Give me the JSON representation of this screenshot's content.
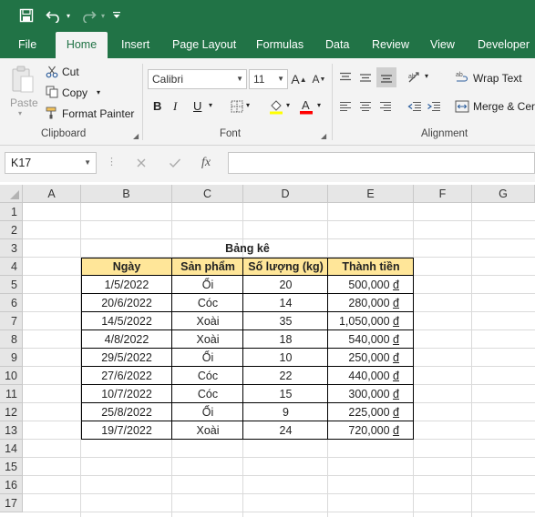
{
  "quick_access": {
    "save_icon": "save-icon",
    "undo_icon": "undo-icon",
    "redo_icon": "redo-icon",
    "customize_icon": "customize-icon"
  },
  "tabs": [
    {
      "label": "File"
    },
    {
      "label": "Home"
    },
    {
      "label": "Insert"
    },
    {
      "label": "Page Layout"
    },
    {
      "label": "Formulas"
    },
    {
      "label": "Data"
    },
    {
      "label": "Review"
    },
    {
      "label": "View"
    },
    {
      "label": "Developer"
    }
  ],
  "active_tab": "Home",
  "ribbon": {
    "clipboard": {
      "paste": "Paste",
      "cut": "Cut",
      "copy": "Copy",
      "format_painter": "Format Painter",
      "group_label": "Clipboard"
    },
    "font": {
      "font_name": "Calibri",
      "font_size": "11",
      "bold": "B",
      "italic": "I",
      "underline": "U",
      "group_label": "Font"
    },
    "alignment": {
      "wrap_text": "Wrap Text",
      "merge": "Merge & Cer",
      "group_label": "Alignment"
    }
  },
  "formula_bar": {
    "name_box": "K17",
    "fx": "fx",
    "formula": ""
  },
  "sheet": {
    "columns": [
      "A",
      "B",
      "C",
      "D",
      "E",
      "F",
      "G"
    ],
    "rows": [
      "1",
      "2",
      "3",
      "4",
      "5",
      "6",
      "7",
      "8",
      "9",
      "10",
      "11",
      "12",
      "13",
      "14",
      "15",
      "16",
      "17"
    ],
    "table_title": "Bảng kê",
    "headers": [
      "Ngày",
      "Sản phẩm",
      "Số lượng (kg)",
      "Thành tiền"
    ],
    "currency_symbol": "đ",
    "data": [
      [
        "1/5/2022",
        "Ổi",
        "20",
        "500,000"
      ],
      [
        "20/6/2022",
        "Cóc",
        "14",
        "280,000"
      ],
      [
        "14/5/2022",
        "Xoài",
        "35",
        "1,050,000"
      ],
      [
        "4/8/2022",
        "Xoài",
        "18",
        "540,000"
      ],
      [
        "29/5/2022",
        "Ổi",
        "10",
        "250,000"
      ],
      [
        "27/6/2022",
        "Cóc",
        "22",
        "440,000"
      ],
      [
        "10/7/2022",
        "Cóc",
        "15",
        "300,000"
      ],
      [
        "25/8/2022",
        "Ổi",
        "9",
        "225,000"
      ],
      [
        "19/7/2022",
        "Xoài",
        "24",
        "720,000"
      ]
    ]
  },
  "colors": {
    "excel_green": "#217346",
    "header_fill": "#ffe699"
  }
}
